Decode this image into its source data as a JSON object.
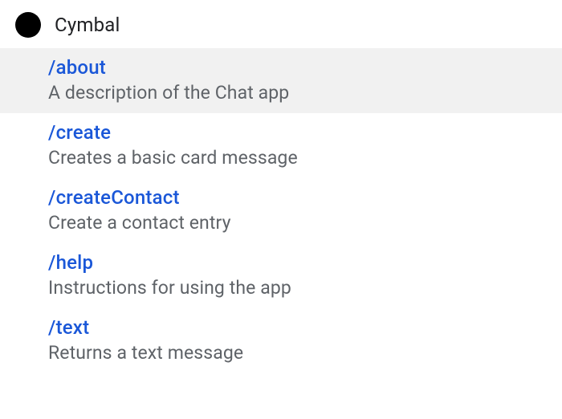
{
  "header": {
    "app_name": "Cymbal"
  },
  "commands": [
    {
      "name": "/about",
      "description": "A description of the Chat app",
      "selected": true
    },
    {
      "name": "/create",
      "description": "Creates a basic card message",
      "selected": false
    },
    {
      "name": "/createContact",
      "description": "Create a contact entry",
      "selected": false
    },
    {
      "name": "/help",
      "description": "Instructions for using the app",
      "selected": false
    },
    {
      "name": "/text",
      "description": "Returns a text message",
      "selected": false
    }
  ]
}
